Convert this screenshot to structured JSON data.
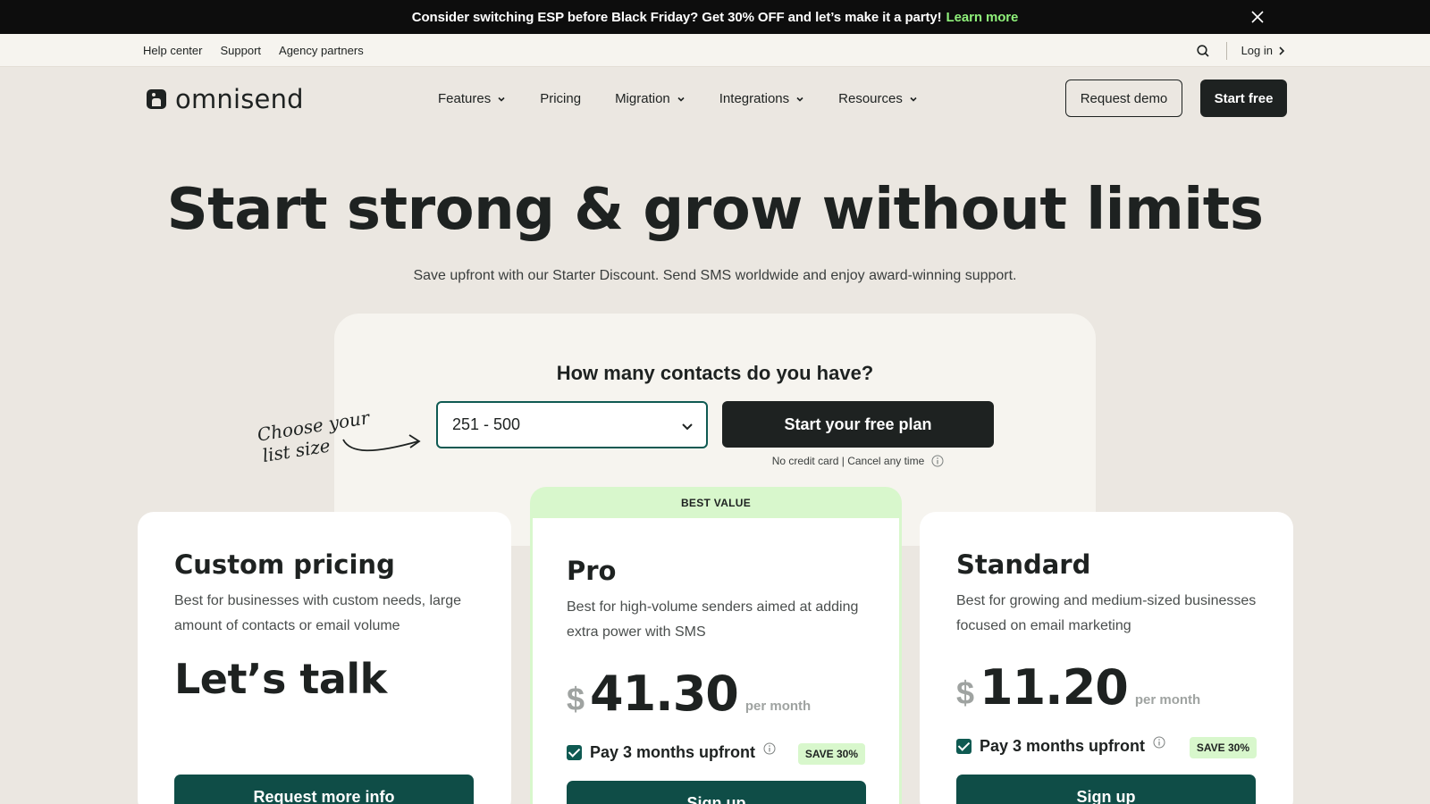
{
  "announcement": {
    "message": "Consider switching ESP before Black Friday? Get 30% OFF and let’s make it a party!",
    "link": "Learn more"
  },
  "utility": {
    "links": [
      "Help center",
      "Support",
      "Agency partners"
    ],
    "login": "Log in"
  },
  "nav": {
    "brand": "omnisend",
    "menu": [
      "Features",
      "Pricing",
      "Migration",
      "Integrations",
      "Resources"
    ],
    "request_demo": "Request demo",
    "start_free": "Start free"
  },
  "hero": {
    "title": "Start strong & grow without limits",
    "subtitle": "Save upfront with our Starter Discount. Send SMS worldwide and enjoy award-winning support."
  },
  "contacts": {
    "question": "How many contacts do you have?",
    "selected": "251 - 500",
    "cta": "Start your free plan",
    "note": "No credit card | Cancel any time",
    "hand_note_line1": "Choose your",
    "hand_note_line2": "list size"
  },
  "plans": {
    "custom": {
      "title": "Custom pricing",
      "description": "Best for businesses with custom needs, large amount of contacts or email volume",
      "headline": "Let’s talk",
      "cta": "Request more info"
    },
    "pro": {
      "badge": "BEST VALUE",
      "title": "Pro",
      "description": "Best for high-volume senders aimed at adding extra power with SMS",
      "currency": "$",
      "price": "41.30",
      "period": "per month",
      "upfront": "Pay 3 months upfront",
      "save": "SAVE 30%",
      "cta": "Sign up"
    },
    "standard": {
      "title": "Standard",
      "description": "Best for growing and medium-sized businesses focused on email marketing",
      "currency": "$",
      "price": "11.20",
      "period": "per month",
      "upfront": "Pay 3 months upfront",
      "save": "SAVE 30%",
      "cta": "Sign up"
    }
  },
  "colors": {
    "accent_green": "#0f4d47",
    "highlight_green": "#d8f7cc",
    "link_green": "#8ff07a",
    "background": "#ebe7e1"
  }
}
